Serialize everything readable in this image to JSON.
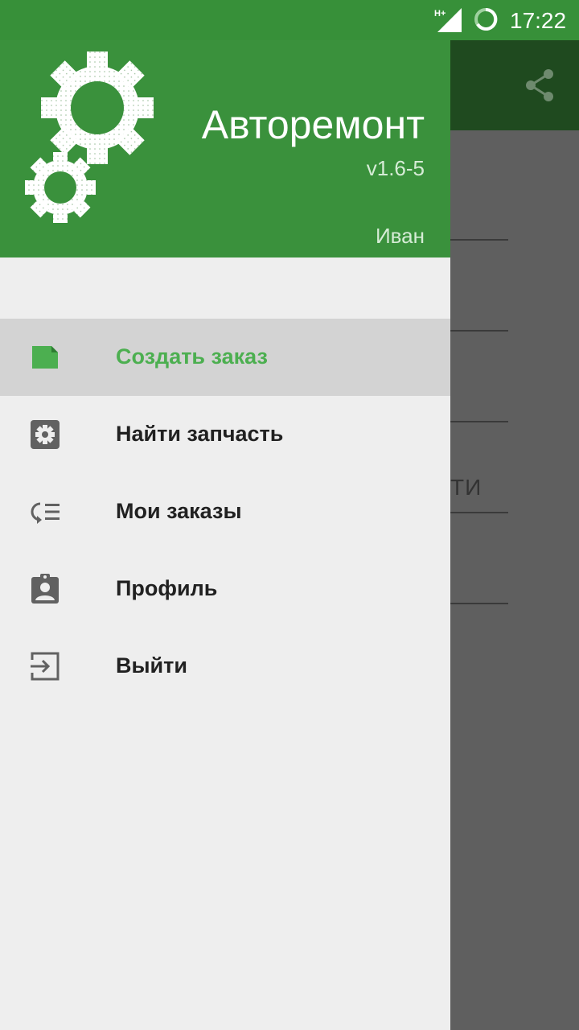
{
  "status_bar": {
    "network": "H+",
    "time": "17:22"
  },
  "background": {
    "partial_text": "ТИ",
    "share_icon": "share-icon"
  },
  "drawer": {
    "header": {
      "title": "Авторемонт",
      "version": "v1.6-5",
      "user": "Иван",
      "logo_icon": "gears-icon"
    },
    "items": [
      {
        "label": "Создать заказ",
        "icon": "new-note-icon",
        "active": true
      },
      {
        "label": "Найти запчасть",
        "icon": "gear-box-icon",
        "active": false
      },
      {
        "label": "Мои заказы",
        "icon": "list-icon",
        "active": false
      },
      {
        "label": "Профиль",
        "icon": "profile-clipboard-icon",
        "active": false
      },
      {
        "label": "Выйти",
        "icon": "logout-icon",
        "active": false
      }
    ]
  },
  "colors": {
    "primary": "#3a913c",
    "primary_dark": "#1f4a1f",
    "accent": "#4caf50",
    "drawer_bg": "#eeeeee",
    "active_bg": "#d3d3d3"
  }
}
